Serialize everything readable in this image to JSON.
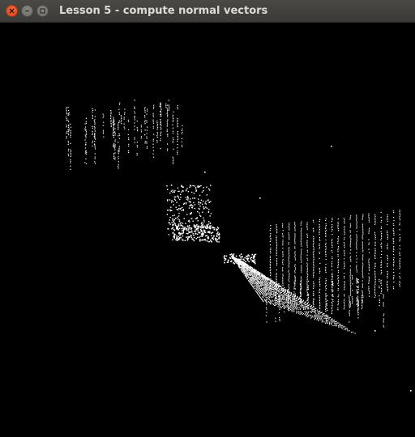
{
  "window": {
    "title": "Lesson 5 - compute normal vectors"
  },
  "controls": {
    "close_icon": "close-icon",
    "minimize_icon": "minimize-icon",
    "maximize_icon": "maximize-icon"
  },
  "viewport": {
    "background": "#000000",
    "point_color": "#ffffff",
    "content": "point-cloud"
  }
}
